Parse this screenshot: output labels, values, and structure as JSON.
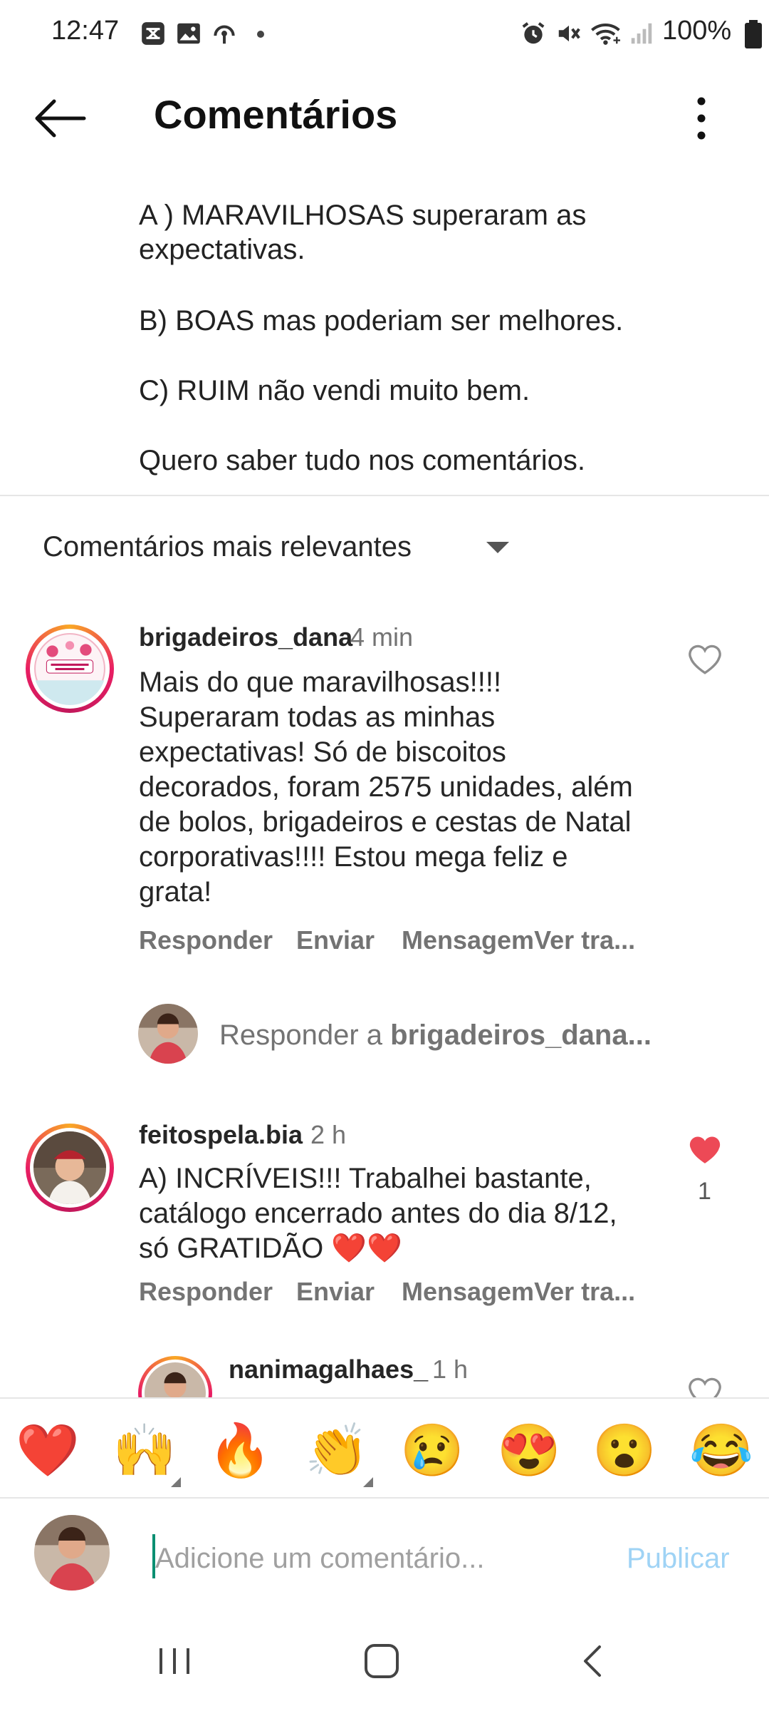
{
  "status_bar": {
    "time": "12:47",
    "battery": "100%",
    "left_icons": [
      "gallery-box-icon",
      "image-icon",
      "headset-icon",
      "dot-icon"
    ],
    "right_icons": [
      "alarm-icon",
      "mute-icon",
      "wifi-icon",
      "signal-icon",
      "battery-icon"
    ]
  },
  "header": {
    "title": "Comentários"
  },
  "caption": {
    "lines": [
      "A ) MARAVILHOSAS superaram as",
      "expectativas.",
      "B) BOAS mas poderiam ser melhores.",
      "C) RUIM não vendi muito bem.",
      "Quero saber tudo nos comentários."
    ]
  },
  "sort": {
    "label": "Comentários mais relevantes"
  },
  "comments": [
    {
      "username": "brigadeiros_dana",
      "time": "4 min",
      "text_lines": [
        "Mais do que maravilhosas!!!!",
        "Superaram todas as minhas",
        "expectativas! Só de biscoitos",
        "decorados, foram 2575 unidades, além",
        "de bolos, brigadeiros e cestas de Natal",
        "corporativas!!!! Estou mega feliz e",
        "grata!"
      ],
      "actions": [
        "Responder",
        "Enviar",
        "MensagemVer tra..."
      ],
      "liked": false
    },
    {
      "username": "feitospela.bia",
      "time": "2 h",
      "text_lines": [
        "A) INCRÍVEIS!!! Trabalhei bastante,",
        "catálogo encerrado antes do dia 8/12,",
        "só  GRATIDÃO ❤️❤️"
      ],
      "actions": [
        "Responder",
        "Enviar",
        "MensagemVer tra..."
      ],
      "liked": true,
      "like_count": "1"
    },
    {
      "username": "nanimagalhaes_",
      "time": "1 h"
    }
  ],
  "reply_bar": {
    "prefix": "Responder a ",
    "target": "brigadeiros_dana..."
  },
  "emoji_bar": [
    "❤️",
    "🙌",
    "🔥",
    "👏",
    "😢",
    "😍",
    "😮",
    "😂"
  ],
  "composer": {
    "placeholder": "Adicione um comentário...",
    "publish_label": "Publicar"
  },
  "colors": {
    "like_red": "#ed4956",
    "publish_disabled": "#9fd3f5"
  }
}
